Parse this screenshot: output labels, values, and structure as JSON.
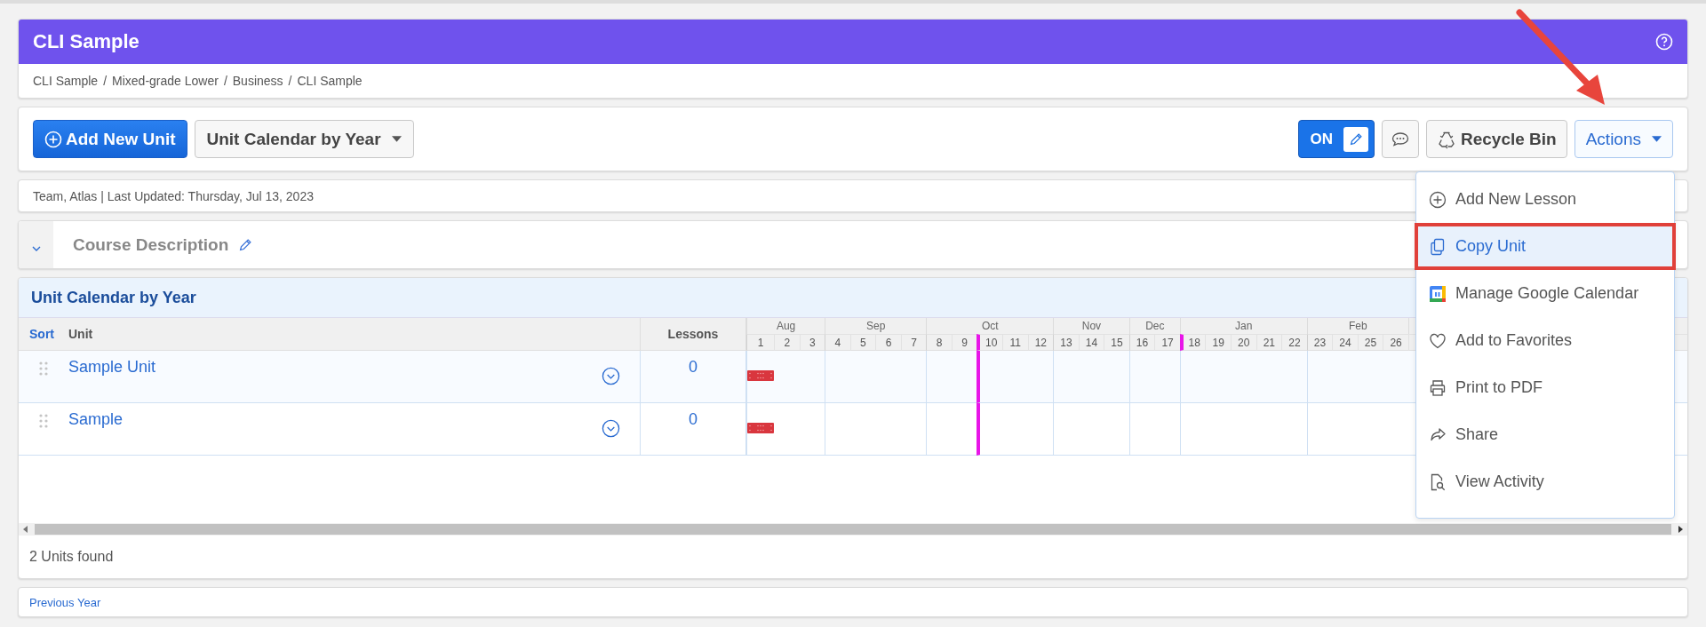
{
  "header": {
    "title": "CLI Sample"
  },
  "breadcrumb": {
    "separator": "/",
    "items": [
      "CLI Sample",
      "Mixed-grade Lower",
      "Business",
      "CLI Sample"
    ]
  },
  "toolbar": {
    "add_button": "Add New Unit",
    "view_select": "Unit Calendar by Year",
    "edit_toggle": {
      "label": "ON",
      "on": true
    },
    "recycle_button": "Recycle Bin",
    "actions_button": "Actions"
  },
  "info": "Team, Atlas | Last Updated: Thursday, Jul 13, 2023",
  "course_description": {
    "title": "Course Description"
  },
  "calendar": {
    "title": "Unit Calendar by Year",
    "sort_label": "Sort",
    "unit_column": "Unit",
    "lessons_column": "Lessons",
    "months": [
      {
        "name": "Aug",
        "weeks": [
          {
            "label": "1",
            "marker": false
          },
          {
            "label": "2",
            "marker": false
          },
          {
            "label": "3",
            "marker": false
          }
        ]
      },
      {
        "name": "Sep",
        "weeks": [
          {
            "label": "4",
            "marker": false
          },
          {
            "label": "5",
            "marker": false
          },
          {
            "label": "6",
            "marker": false
          },
          {
            "label": "7",
            "marker": false
          }
        ]
      },
      {
        "name": "Oct",
        "weeks": [
          {
            "label": "8",
            "marker": false
          },
          {
            "label": "9",
            "marker": false
          },
          {
            "label": "10",
            "marker": true
          },
          {
            "label": "11",
            "marker": false
          },
          {
            "label": "12",
            "marker": false
          }
        ]
      },
      {
        "name": "Nov",
        "weeks": [
          {
            "label": "13",
            "marker": false
          },
          {
            "label": "14",
            "marker": false
          },
          {
            "label": "15",
            "marker": false
          }
        ]
      },
      {
        "name": "Dec",
        "weeks": [
          {
            "label": "16",
            "marker": false
          },
          {
            "label": "17",
            "marker": false
          }
        ]
      },
      {
        "name": "Jan",
        "weeks": [
          {
            "label": "18",
            "marker": true
          },
          {
            "label": "19",
            "marker": false
          },
          {
            "label": "20",
            "marker": false
          },
          {
            "label": "21",
            "marker": false
          },
          {
            "label": "22",
            "marker": false
          }
        ]
      },
      {
        "name": "Feb",
        "weeks": [
          {
            "label": "23",
            "marker": false
          },
          {
            "label": "24",
            "marker": false
          },
          {
            "label": "25",
            "marker": false
          },
          {
            "label": "26",
            "marker": false
          }
        ]
      }
    ],
    "units": [
      {
        "name": "Sample Unit",
        "lessons": "0",
        "calendar_bar": true
      },
      {
        "name": "Sample",
        "lessons": "0",
        "calendar_bar": true
      }
    ],
    "footer": "2 Units found"
  },
  "previous_year": "Previous Year",
  "actions_menu": {
    "items": [
      {
        "kind": "add",
        "label": "Add New Lesson",
        "selected": false
      },
      {
        "kind": "copy",
        "label": "Copy Unit",
        "selected": true
      },
      {
        "kind": "calendar",
        "label": "Manage Google Calendar",
        "selected": false
      },
      {
        "kind": "favorite",
        "label": "Add to Favorites",
        "selected": false
      },
      {
        "kind": "print",
        "label": "Print to PDF",
        "selected": false
      },
      {
        "kind": "share",
        "label": "Share",
        "selected": false
      },
      {
        "kind": "activity",
        "label": "View Activity",
        "selected": false
      }
    ]
  }
}
